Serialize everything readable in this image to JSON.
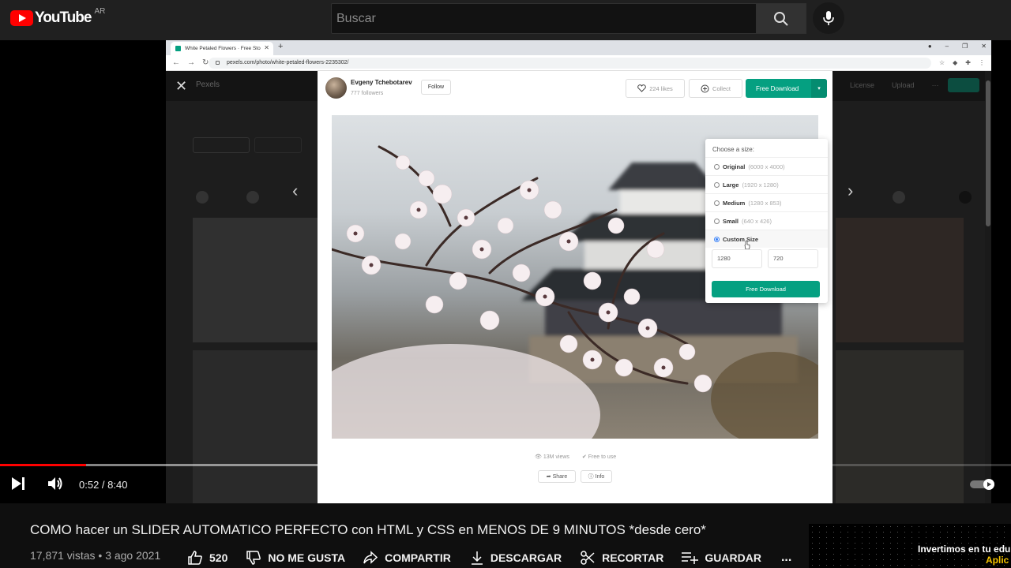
{
  "header": {
    "logo_text": "YouTube",
    "country": "AR",
    "search_placeholder": "Buscar"
  },
  "browser": {
    "tab_title": "White Petaled Flowers · Free Sto",
    "url": "pexels.com/photo/white-petaled-flowers-2235302/"
  },
  "modal": {
    "author_name": "Evgeny Tchebotarev",
    "author_followers": "777 followers",
    "follow_label": "Follow",
    "likes_label": "224 likes",
    "collect_label": "Collect",
    "download_label": "Free Download",
    "views": "13M views",
    "license": "Free to use",
    "share_label": "Share",
    "info_label": "Info"
  },
  "size_menu": {
    "title": "Choose a size:",
    "options": [
      {
        "name": "Original",
        "dims": "(6000 x 4000)"
      },
      {
        "name": "Large",
        "dims": "(1920 x 1280)"
      },
      {
        "name": "Medium",
        "dims": "(1280 x 853)"
      },
      {
        "name": "Small",
        "dims": "(640 x 426)"
      },
      {
        "name": "Custom Size",
        "dims": ""
      }
    ],
    "selected_index": 4,
    "custom_width": "1280",
    "custom_height": "720",
    "download_label": "Free Download"
  },
  "player": {
    "time": "0:52 / 8:40",
    "played_fraction": 0.1,
    "buffered_fraction": 0.93
  },
  "video": {
    "title": "COMO hacer un SLIDER AUTOMATICO PERFECTO con HTML y CSS en MENOS DE 9 MINUTOS *desde cero*",
    "views": "17,871 vistas",
    "date": "3 ago 2021",
    "likes": "520",
    "dislike_label": "NO ME GUSTA",
    "share_label": "COMPARTIR",
    "download_label": "DESCARGAR",
    "clip_label": "RECORTAR",
    "save_label": "GUARDAR",
    "more_label": "..."
  },
  "promo": {
    "line1": "Invertimos en tu edu",
    "line2": "Aplic"
  },
  "colors": {
    "brand_red": "#ff0000",
    "pexels_green": "#05a081",
    "background": "#0f0f0f"
  }
}
